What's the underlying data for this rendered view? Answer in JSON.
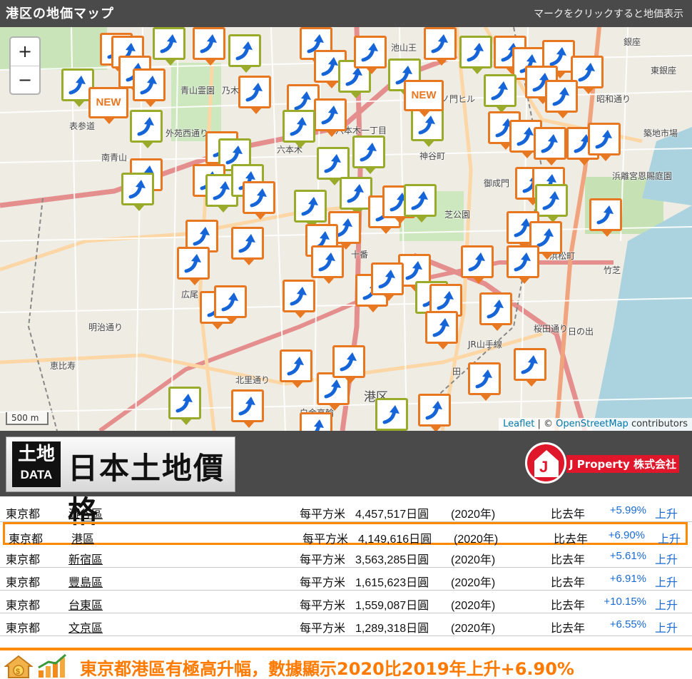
{
  "header": {
    "title": "港区の地価マップ",
    "hint": "マークをクリックすると地価表示"
  },
  "map": {
    "zoom_in": "+",
    "zoom_out": "−",
    "scale": "500 m",
    "attribution": {
      "leaflet": "Leaflet",
      "sep": " | © ",
      "osm": "OpenStreetMap",
      "contributors": " contributors"
    },
    "new_label": "NEW",
    "labels": {
      "omotesando": "表参道",
      "aoyama_cemetery": "青山霊園",
      "nogizaka": "乃木坂",
      "roppongi_1": "六本木一丁目",
      "roppongi": "六本木",
      "kamiyacho": "神谷町",
      "onarimon": "御成門",
      "shiba_park": "芝公園",
      "hamarikyu": "浜離宮恩賜庭園",
      "tsukiji_market": "築地市場",
      "higashi_ginza": "東銀座",
      "ginza": "銀座",
      "tameike": "池山王",
      "toranomon": "ノ門ヒル",
      "azabu_juban": "十番",
      "hiroo": "広尾",
      "ebisu": "恵比寿",
      "meiji_dori": "明治通り",
      "kitasato": "北里通り",
      "shirokane": "白金高輪",
      "minato_ku": "港区",
      "hinode": "日の出",
      "takeshiba": "竹芝",
      "hamamatsucho": "浜松町",
      "mita": "田",
      "jr": "JR山手線",
      "gaien": "外苑西通り",
      "sakurada": "桜田通り",
      "showa": "昭和通り",
      "minami_aoyama": "南青山"
    }
  },
  "logos": {
    "left_box_top": "土地",
    "left_box_bottom": "DATA",
    "left_name": "日本土地價格",
    "right_j": "J",
    "right_name": "J Property 株式会社"
  },
  "table": {
    "rows": [
      {
        "pref": "東京都",
        "ward": "澀谷區",
        "unit": "每平方米",
        "price": "4,457,517日圓",
        "year": "(2020年)",
        "cmp": "比去年",
        "pct": "+5.99%",
        "dir": "上升"
      },
      {
        "pref": "東京都",
        "ward": "港區",
        "unit": "每平方米",
        "price": "4,149,616日圓",
        "year": "(2020年)",
        "cmp": "比去年",
        "pct": "+6.90%",
        "dir": "上升"
      },
      {
        "pref": "東京都",
        "ward": "新宿區",
        "unit": "每平方米",
        "price": "3,563,285日圓",
        "year": "(2020年)",
        "cmp": "比去年",
        "pct": "+5.61%",
        "dir": "上升"
      },
      {
        "pref": "東京都",
        "ward": "豐島區",
        "unit": "每平方米",
        "price": "1,615,623日圓",
        "year": "(2020年)",
        "cmp": "比去年",
        "pct": "+6.91%",
        "dir": "上升"
      },
      {
        "pref": "東京都",
        "ward": "台東區",
        "unit": "每平方米",
        "price": "1,559,087日圓",
        "year": "(2020年)",
        "cmp": "比去年",
        "pct": "+10.15%",
        "dir": "上升"
      },
      {
        "pref": "東京都",
        "ward": "文京區",
        "unit": "每平方米",
        "price": "1,289,318日圓",
        "year": "(2020年)",
        "cmp": "比去年",
        "pct": "+6.55%",
        "dir": "上升"
      }
    ]
  },
  "banner": {
    "text": "東京都港區有極高升幅，數據顯示2020比2019年上升+6.90%"
  },
  "colors": {
    "header_bg": "#4a4a4a",
    "marker_orange": "#e87722",
    "marker_green": "#9aaa2a",
    "arrow_blue": "#1565d8",
    "highlight": "#ff8a00",
    "pct_blue": "#1a6ad0",
    "brand_red": "#e0162b"
  }
}
